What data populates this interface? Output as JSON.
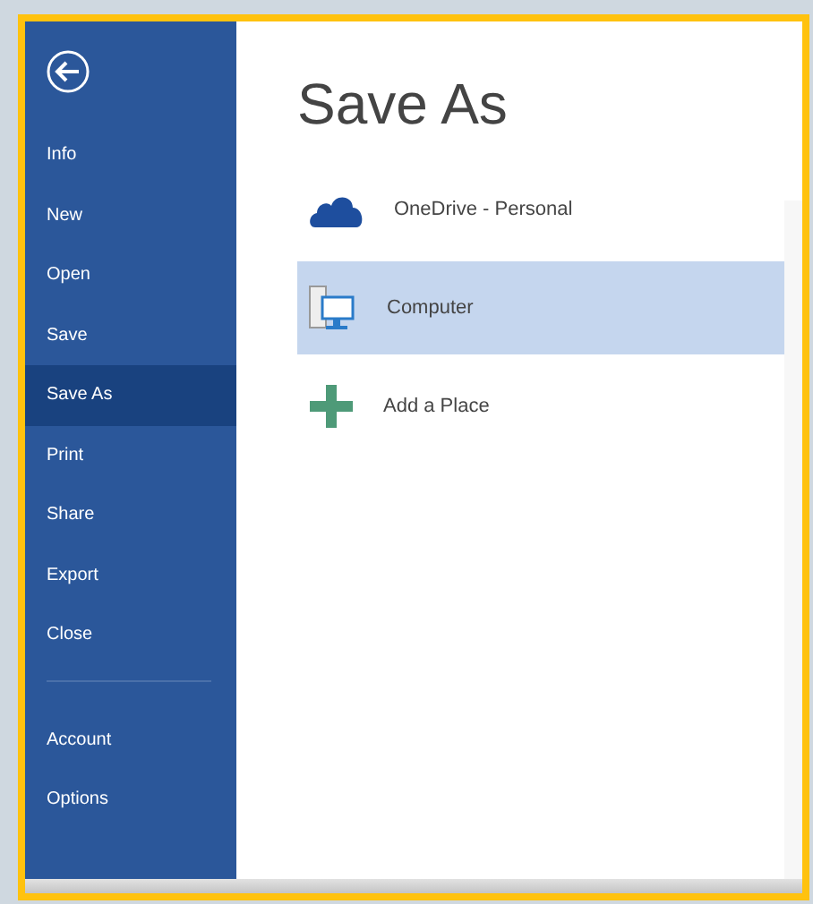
{
  "sidebar": {
    "items": [
      {
        "label": "Info",
        "selected": false
      },
      {
        "label": "New",
        "selected": false
      },
      {
        "label": "Open",
        "selected": false
      },
      {
        "label": "Save",
        "selected": false
      },
      {
        "label": "Save As",
        "selected": true
      },
      {
        "label": "Print",
        "selected": false
      },
      {
        "label": "Share",
        "selected": false
      },
      {
        "label": "Export",
        "selected": false
      },
      {
        "label": "Close",
        "selected": false
      }
    ],
    "footer_items": [
      {
        "label": "Account",
        "selected": false
      },
      {
        "label": "Options",
        "selected": false
      }
    ]
  },
  "title": "Save As",
  "places": [
    {
      "kind": "cloud",
      "label": "OneDrive - Personal",
      "selected": false
    },
    {
      "kind": "computer",
      "label": "Computer",
      "selected": true
    },
    {
      "kind": "add",
      "label": "Add a Place",
      "selected": false
    }
  ]
}
